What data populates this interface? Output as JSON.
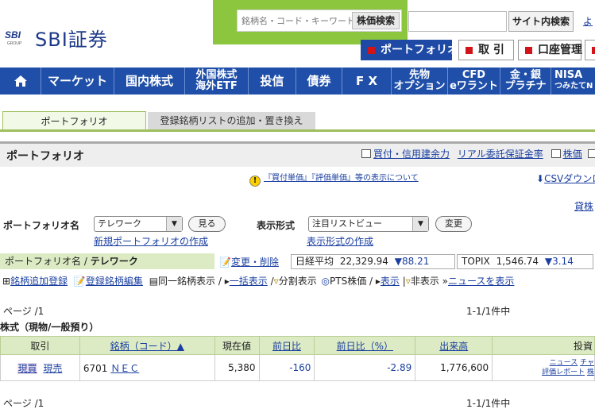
{
  "brand": {
    "logo_mark": "SBI",
    "logo_group": "GROUP",
    "name": "SBI証券"
  },
  "search": {
    "placeholder": "銘柄名・コード・キーワード",
    "button": "株価検索",
    "site_button": "サイト内検索",
    "top_link": "よ"
  },
  "account_tabs": [
    {
      "label": "ポートフォリオ",
      "active": true
    },
    {
      "label": "取 引",
      "active": false
    },
    {
      "label": "口座管理",
      "active": false
    }
  ],
  "nav": {
    "home_icon": "home-icon",
    "items": [
      {
        "label": "マーケット"
      },
      {
        "label": "国内株式"
      },
      {
        "line1": "外国株式",
        "line2": "海外ETF"
      },
      {
        "label": "投信"
      },
      {
        "label": "債券"
      },
      {
        "label": "F X"
      },
      {
        "line1": "先物",
        "line2": "オプション"
      },
      {
        "line1": "CFD",
        "line2": "eワラント"
      },
      {
        "line1": "金・銀",
        "line2": "プラチナ"
      },
      {
        "line1": "NISA",
        "line2": "つみたてN"
      }
    ]
  },
  "subtabs": {
    "portfolio": "ポートフォリオ",
    "register": "登録銘柄リストの追加・置き換え"
  },
  "section": {
    "title": "ポートフォリオ",
    "link1": "買付・信用建余力",
    "link2": "リアル委託保証金率",
    "link3": "株価"
  },
  "notice": {
    "text": "『買付単価』『評価単価』等の表示について",
    "csv": "CSVダウンロード",
    "kashikabu": "貸株"
  },
  "controls": {
    "pf_label": "ポートフォリオ名",
    "pf_value": "テレワーク",
    "view_button": "見る",
    "new_pf_link": "新規ポートフォリオの作成",
    "display_label": "表示形式",
    "display_value": "注目リストビュー",
    "change_button": "変更",
    "display_create_link": "表示形式の作成"
  },
  "pf_bar": {
    "label": "ポートフォリオ名 / ",
    "name": "テレワーク",
    "edit_link": "変更・削除",
    "nikkei_label": "日経平均",
    "nikkei_value": "22,329.94",
    "nikkei_change": "▼88.21",
    "topix_label": "TOPIX",
    "topix_value": "1,546.74",
    "topix_change": "▼3.14"
  },
  "tools": {
    "add": "銘柄追加登録",
    "edit": "登録銘柄編集",
    "same_label": "同一銘柄表示 / ",
    "bulk": "一括表示",
    "split": "分割表示",
    "pts_label": "PTS株価 / ",
    "pts_show": "表示",
    "hide": "非表示",
    "news": "ニュースを表示"
  },
  "paging": {
    "page": "ページ /1",
    "count": "1-1/1件中"
  },
  "table": {
    "title": "株式（現物/一般預り）",
    "headers": {
      "trade": "取引",
      "name": "銘柄（コード）▲",
      "price": "現在値",
      "change": "前日比",
      "change_pct": "前日比（%）",
      "volume": "出来高",
      "invest": "投資"
    },
    "rows": [
      {
        "buy": "現買",
        "sell": "現売",
        "code": "6701",
        "name": "ＮＥＣ",
        "price": "5,380",
        "change": "-160",
        "change_pct": "-2.89",
        "volume": "1,776,600",
        "info_news": "ニュース",
        "info_chart": "チャ",
        "info_report": "評価レポート",
        "info_stock": "株"
      }
    ]
  },
  "paging_bottom": {
    "page": "ページ /1",
    "count": "1-1/1件中"
  },
  "colors": {
    "nav_blue": "#1f4fa8",
    "green": "#8cc63f",
    "header_green": "#dcebc4",
    "link": "#1a3fa0",
    "down": "#1a3fa0"
  }
}
